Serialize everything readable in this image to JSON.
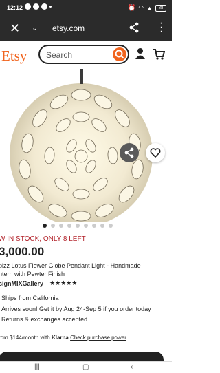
{
  "status_bar": {
    "time": "12:12",
    "battery": "88"
  },
  "browser": {
    "url": "etsy.com"
  },
  "header": {
    "logo": "Etsy",
    "search_placeholder": "Search"
  },
  "product": {
    "stock": "W IN STOCK, ONLY 8 LEFT",
    "price": "3,000.00",
    "title": "pizz Lotus Flower Globe Pendant Light - Handmade\nntern with Pewter Finish",
    "shop": "signMIXGallery",
    "stars": "★★★★★",
    "ships_from": "Ships from California",
    "arrives_prefix": "Arrives soon! Get it by ",
    "arrives_dates": "Aug 24-Sep 5",
    "arrives_suffix": " if you order today",
    "returns": "Returns & exchanges accepted",
    "klarna_text": "rom $144/month with ",
    "klarna_brand": "Klarna",
    "klarna_link": "Check purchase power"
  },
  "carousel": {
    "count": 9,
    "active": 0
  },
  "colors": {
    "accent": "#f1641e",
    "stock": "#b3242c"
  }
}
